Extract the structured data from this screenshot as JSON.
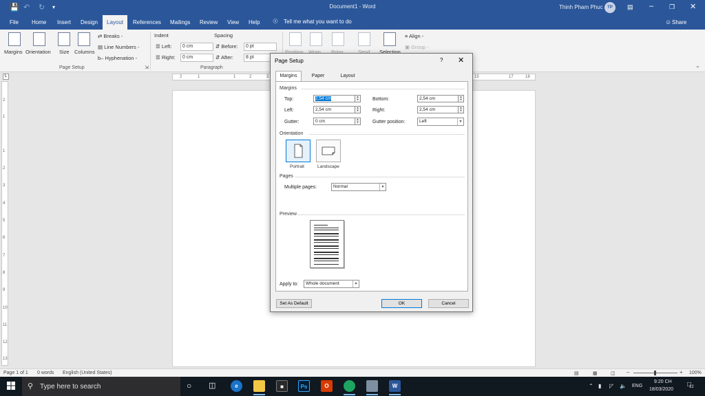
{
  "window": {
    "doc_title": "Document1  -  Word",
    "user_name": "Thinh Pham Phuc",
    "user_initials": "TP"
  },
  "menu": {
    "tabs": [
      "File",
      "Home",
      "Insert",
      "Design",
      "Layout",
      "References",
      "Mailings",
      "Review",
      "View",
      "Help"
    ],
    "active_tab": "Layout",
    "tell_me": "Tell me what you want to do",
    "share": "Share"
  },
  "ribbon": {
    "page_setup": {
      "margins": "Margins",
      "orientation": "Orientation",
      "size": "Size",
      "columns": "Columns",
      "breaks": "Breaks -",
      "line_numbers": "Line Numbers -",
      "hyphenation": "Hyphenation -",
      "group_label": "Page Setup"
    },
    "paragraph": {
      "indent_label": "Indent",
      "spacing_label": "Spacing",
      "left_label": "Left:",
      "left_value": "0 cm",
      "right_label": "Right:",
      "right_value": "0 cm",
      "before_label": "Before:",
      "before_value": "0 pt",
      "after_label": "After:",
      "after_value": "8 pt",
      "group_label": "Paragraph"
    },
    "arrange": {
      "position": "Position",
      "wrap": "Wrap",
      "bring": "Bring",
      "send": "Send",
      "selection": "Selection",
      "align": "Align -",
      "group": "Group -"
    }
  },
  "ruler": {
    "h_ticks": [
      "2",
      "1",
      "1",
      "2",
      "3",
      "15",
      "17",
      "18"
    ],
    "v_ticks": [
      "2",
      "1",
      "1",
      "2",
      "3",
      "4",
      "5",
      "6",
      "7",
      "8",
      "9",
      "10",
      "11",
      "12",
      "13"
    ]
  },
  "status": {
    "page": "Page 1 of 1",
    "words": "0 words",
    "language": "English (United States)",
    "zoom": "100%"
  },
  "taskbar": {
    "search_placeholder": "Type here to search",
    "language": "ENG",
    "time": "9:20 CH",
    "date": "18/03/2020",
    "notifications": "12"
  },
  "dialog": {
    "title": "Page Setup",
    "help": "?",
    "tabs": [
      "Margins",
      "Paper",
      "Layout"
    ],
    "active_tab": "Margins",
    "margins_section": "Margins",
    "top_label": "Top:",
    "top_value": "2,54 cm",
    "bottom_label": "Bottom:",
    "bottom_value": "2,54 cm",
    "left_label": "Left:",
    "left_value": "2,54 cm",
    "right_label": "Right:",
    "right_value": "2,54 cm",
    "gutter_label": "Gutter:",
    "gutter_value": "0 cm",
    "gutter_pos_label": "Gutter position:",
    "gutter_pos_value": "Left",
    "orientation_section": "Orientation",
    "portrait": "Portrait",
    "landscape": "Landscape",
    "orientation_selected": "Portrait",
    "pages_section": "Pages",
    "multiple_pages_label": "Multiple pages:",
    "multiple_pages_value": "Normal",
    "preview_section": "Preview",
    "apply_to_label": "Apply to:",
    "apply_to_value": "Whole document",
    "set_default": "Set As Default",
    "ok": "OK",
    "cancel": "Cancel"
  }
}
